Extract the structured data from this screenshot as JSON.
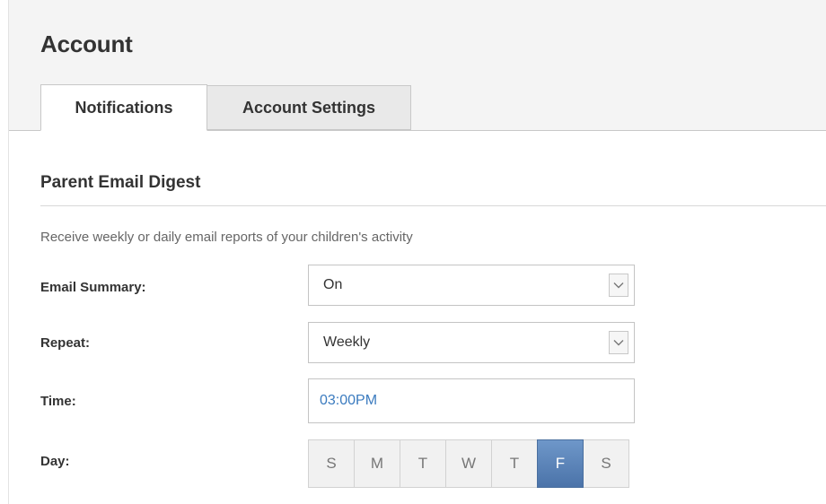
{
  "page": {
    "title": "Account"
  },
  "tabs": [
    {
      "label": "Notifications",
      "active": true
    },
    {
      "label": "Account Settings",
      "active": false
    }
  ],
  "section": {
    "title": "Parent Email Digest",
    "description": "Receive weekly or daily email reports of your children's activity"
  },
  "form": {
    "email_summary": {
      "label": "Email Summary:",
      "value": "On",
      "icon": "chevron-down-icon"
    },
    "repeat": {
      "label": "Repeat:",
      "value": "Weekly",
      "icon": "chevron-down-icon"
    },
    "time": {
      "label": "Time:",
      "value": "03:00PM"
    },
    "day": {
      "label": "Day:",
      "options": [
        "S",
        "M",
        "T",
        "W",
        "T",
        "F",
        "S"
      ],
      "selected_index": 5
    }
  },
  "colors": {
    "accent": "#4b73a9",
    "time_text": "#3b7bbf",
    "header_bg": "#f4f4f4"
  }
}
